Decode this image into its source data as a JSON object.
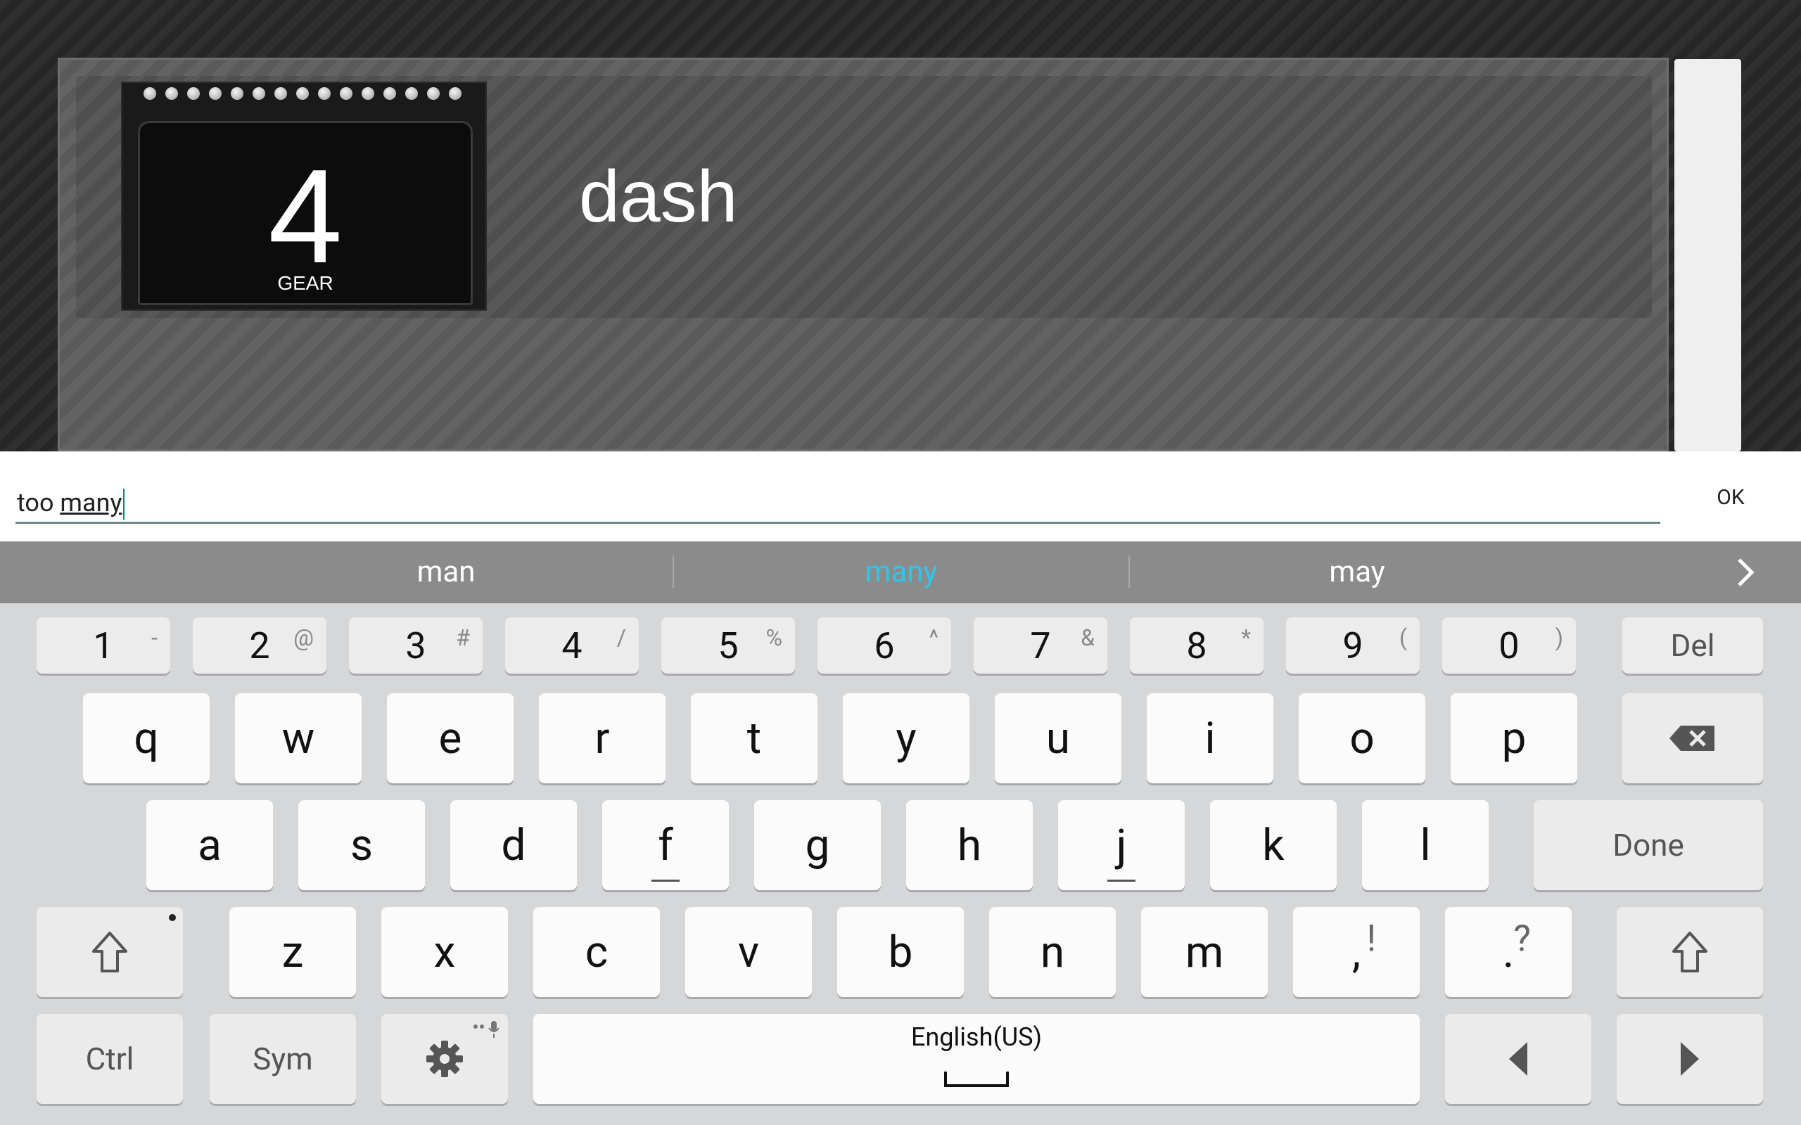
{
  "item": {
    "gear_number": "4",
    "gear_label": "GEAR",
    "title": "dash"
  },
  "input": {
    "prefix": "too ",
    "composing": "many",
    "ok_label": "OK"
  },
  "suggestions": [
    "man",
    "many",
    "may"
  ],
  "keyboard": {
    "numbers": [
      {
        "main": "1",
        "sub": "-"
      },
      {
        "main": "2",
        "sub": "@"
      },
      {
        "main": "3",
        "sub": "#"
      },
      {
        "main": "4",
        "sub": "/"
      },
      {
        "main": "5",
        "sub": "%"
      },
      {
        "main": "6",
        "sub": "^"
      },
      {
        "main": "7",
        "sub": "&"
      },
      {
        "main": "8",
        "sub": "*"
      },
      {
        "main": "9",
        "sub": "("
      },
      {
        "main": "0",
        "sub": ")"
      }
    ],
    "del_label": "Del",
    "row1": [
      "q",
      "w",
      "e",
      "r",
      "t",
      "y",
      "u",
      "i",
      "o",
      "p"
    ],
    "row2": [
      "a",
      "s",
      "d",
      "f",
      "g",
      "h",
      "j",
      "k",
      "l"
    ],
    "done_label": "Done",
    "row3": [
      "z",
      "x",
      "c",
      "v",
      "b",
      "n",
      "m"
    ],
    "comma": {
      "main": ",",
      "sub": "!"
    },
    "period": {
      "main": ".",
      "sub": "?"
    },
    "ctrl_label": "Ctrl",
    "sym_label": "Sym",
    "space_label": "English(US)",
    "icons": {
      "backspace": "backspace-icon",
      "shift": "shift-icon",
      "settings": "gear-icon",
      "left": "arrow-left-icon",
      "right": "arrow-right-icon",
      "more": "chevron-right-icon",
      "mic": "mic-icon"
    }
  },
  "colors": {
    "suggestion_highlight": "#2ec6ea",
    "keyboard_bg": "#d6d7d9",
    "suggestion_bar": "#8b8b8b"
  }
}
